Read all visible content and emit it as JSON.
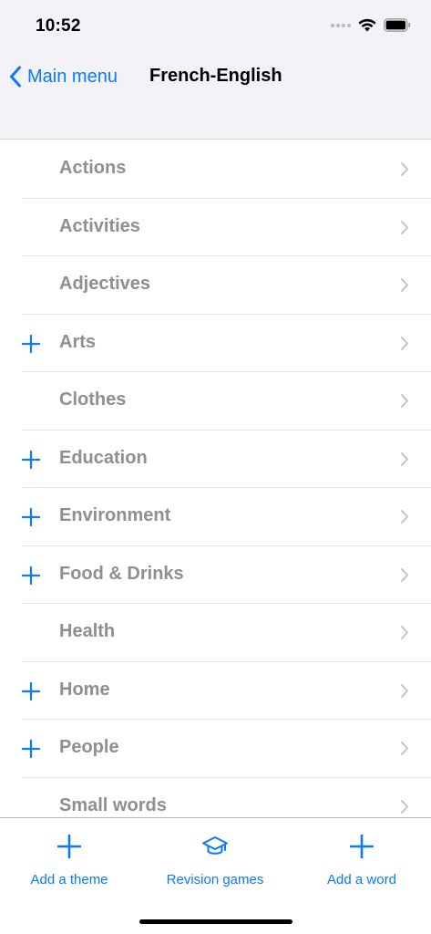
{
  "status_bar": {
    "time": "10:52"
  },
  "nav": {
    "back_label": "Main menu",
    "title": "French-English"
  },
  "themes": [
    {
      "label": "Actions",
      "has_add": false
    },
    {
      "label": "Activities",
      "has_add": false
    },
    {
      "label": "Adjectives",
      "has_add": false
    },
    {
      "label": "Arts",
      "has_add": true
    },
    {
      "label": "Clothes",
      "has_add": false
    },
    {
      "label": "Education",
      "has_add": true
    },
    {
      "label": "Environment",
      "has_add": true
    },
    {
      "label": "Food & Drinks",
      "has_add": true
    },
    {
      "label": "Health",
      "has_add": false
    },
    {
      "label": "Home",
      "has_add": true
    },
    {
      "label": "People",
      "has_add": true
    },
    {
      "label": "Small words",
      "has_add": false
    }
  ],
  "tabbar": {
    "add_theme_label": "Add a theme",
    "revision_label": "Revision games",
    "add_word_label": "Add a word"
  },
  "colors": {
    "accent": "#0a7aff",
    "item_text": "#8e8e93",
    "header_bg": "#f2f2f7"
  },
  "icons": {
    "back": "chevron-left-icon",
    "row_chevron": "chevron-right-icon",
    "row_add": "plus-icon",
    "revision": "graduation-cap-icon"
  }
}
